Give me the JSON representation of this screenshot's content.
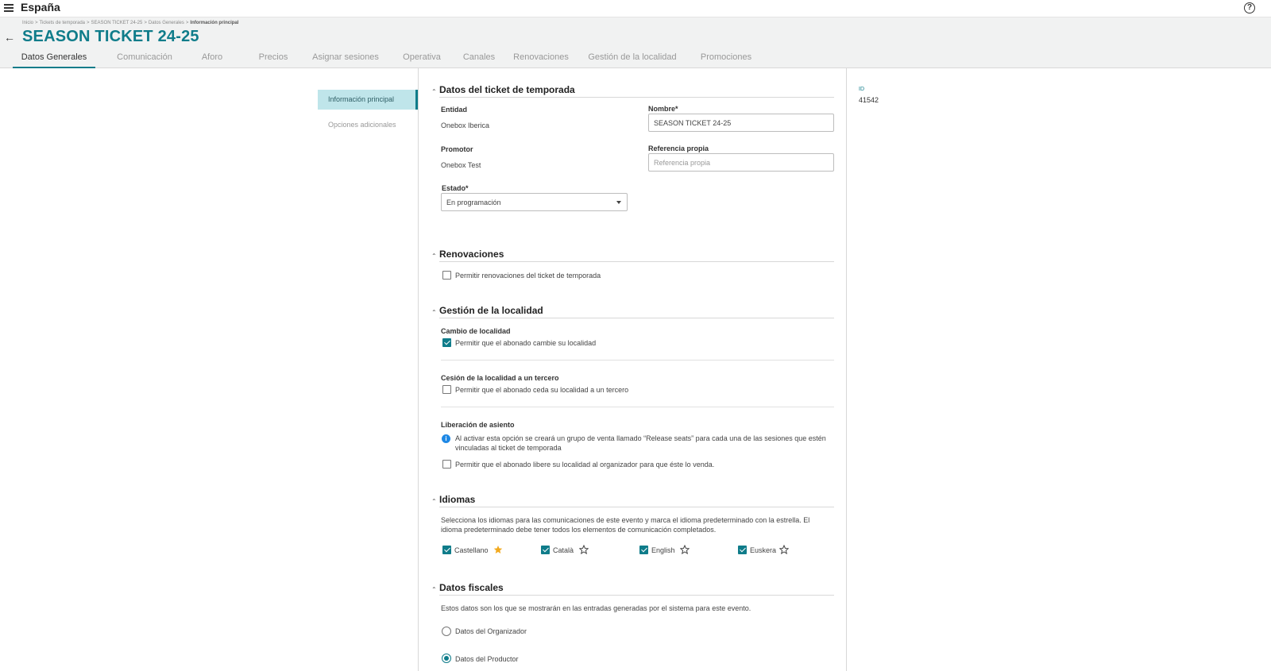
{
  "topbar": {
    "title": "España",
    "help_icon": "help-circle-icon",
    "menu_icon": "hamburger-menu-icon"
  },
  "breadcrumb": [
    "Inicio",
    "Tickets de temporada",
    "SEASON TICKET 24-25",
    "Datos Generales",
    "Información principal"
  ],
  "breadcrumb_sep": ">",
  "page": {
    "title": "SEASON TICKET 24-25",
    "back_icon": "arrow-left-icon"
  },
  "tabs": [
    {
      "label": "Datos Generales",
      "active": true
    },
    {
      "label": "Comunicación"
    },
    {
      "label": "Aforo"
    },
    {
      "label": "Precios"
    },
    {
      "label": "Asignar sesiones"
    },
    {
      "label": "Operativa"
    },
    {
      "label": "Canales"
    },
    {
      "label": "Renovaciones"
    },
    {
      "label": "Gestión de la localidad"
    },
    {
      "label": "Promociones"
    }
  ],
  "sidenav": [
    {
      "label": "Información principal",
      "active": true
    },
    {
      "label": "Opciones adicionales"
    }
  ],
  "info": {
    "id_label": "ID",
    "id_value": "41542"
  },
  "datos": {
    "title": "Datos del ticket de temporada",
    "entidad_label": "Entidad",
    "entidad_value": "Onebox Iberica",
    "nombre_label": "Nombre*",
    "nombre_value": "SEASON TICKET 24-25",
    "promotor_label": "Promotor",
    "promotor_value": "Onebox Test",
    "referencia_label": "Referencia propia",
    "referencia_placeholder": "Referencia propia",
    "estado_label": "Estado*",
    "estado_value": "En programación"
  },
  "renovaciones": {
    "title": "Renovaciones",
    "checkbox_label": "Permitir renovaciones del ticket de temporada",
    "checked": false
  },
  "gestion": {
    "title": "Gestión de la localidad",
    "cambio_label": "Cambio de localidad",
    "cambio_check": "Permitir que el abonado cambie su localidad",
    "cambio_checked": true,
    "cesion_label": "Cesión de la localidad a un tercero",
    "cesion_check": "Permitir que el abonado ceda su localidad a un tercero",
    "cesion_checked": false,
    "liberacion_label": "Liberación de asiento",
    "liberacion_info": "Al activar esta opción se creará un grupo de venta llamado “Release seats” para cada una de las sesiones que estén vinculadas al ticket de temporada",
    "liberacion_check": "Permitir que el abonado libere su localidad al organizador para que éste lo venda.",
    "liberacion_checked": false
  },
  "idiomas": {
    "title": "Idiomas",
    "description": "Selecciona los idiomas para las comunicaciones de este evento y marca el idioma predeterminado con la estrella. El idioma predeterminado debe tener todos los elementos de comunicación completados.",
    "languages": [
      {
        "label": "Castellano",
        "checked": true,
        "default": true
      },
      {
        "label": "Català",
        "checked": true,
        "default": false
      },
      {
        "label": "English",
        "checked": true,
        "default": false
      },
      {
        "label": "Euskera",
        "checked": true,
        "default": false
      }
    ]
  },
  "fiscales": {
    "title": "Datos fiscales",
    "description": "Estos datos son los que se mostrarán en las entradas generadas por el sistema para este evento.",
    "options": [
      {
        "label": "Datos del Organizador",
        "selected": false
      },
      {
        "label": "Datos del Productor",
        "selected": true
      }
    ]
  },
  "colors": {
    "accent": "#0f7c8a",
    "star_active": "#f2a91e",
    "info": "#1e88e5"
  }
}
